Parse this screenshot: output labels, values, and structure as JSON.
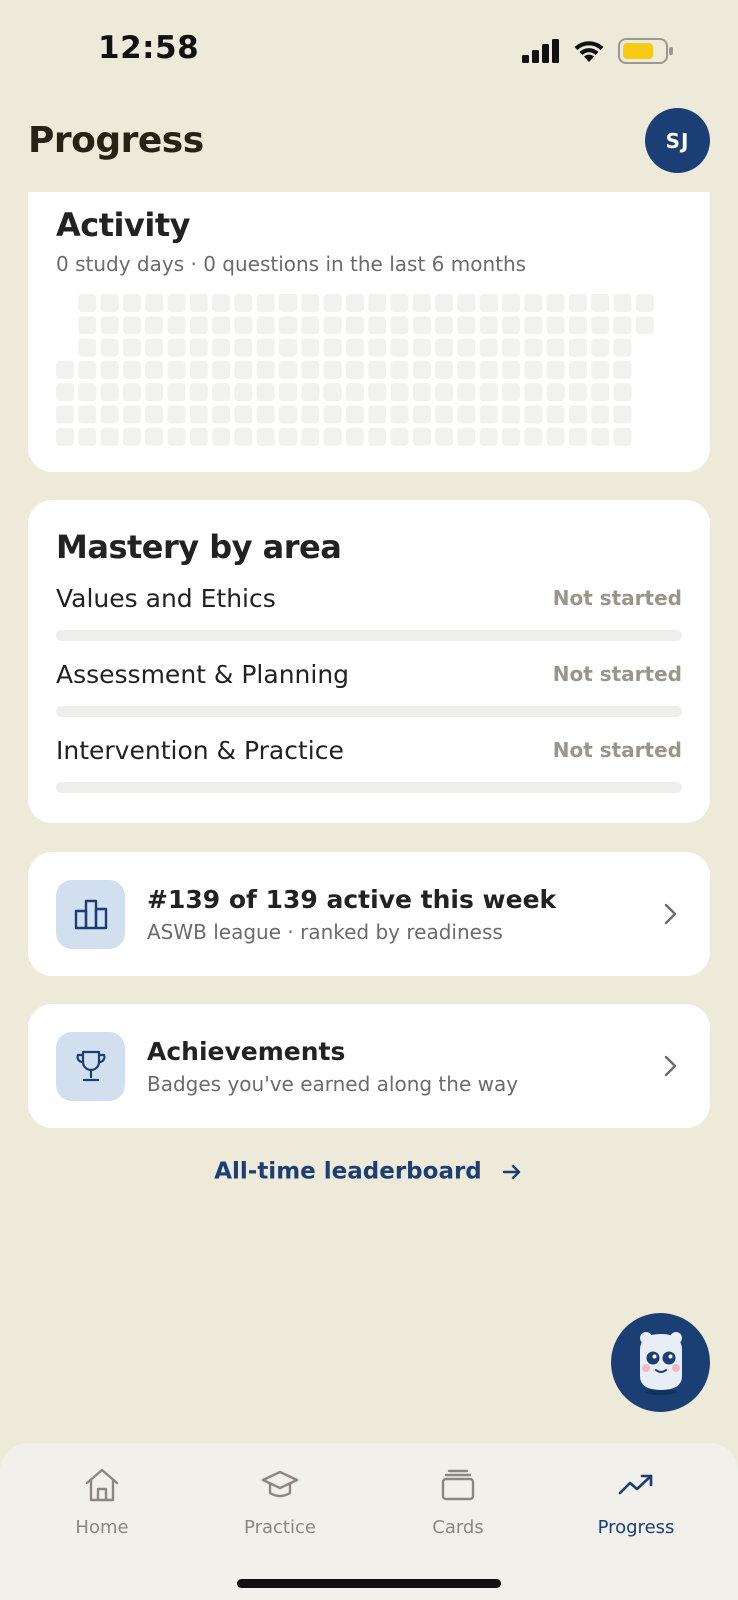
{
  "status_bar": {
    "time": "12:58"
  },
  "header": {
    "title": "Progress",
    "avatar_initials": "SJ"
  },
  "activity": {
    "title": "Activity",
    "subtitle": "0 study days · 0 questions in the last 6 months",
    "study_days": 0,
    "questions": 0
  },
  "mastery": {
    "title": "Mastery by area",
    "areas": [
      {
        "name": "Values and Ethics",
        "status": "Not started",
        "progress": 0
      },
      {
        "name": "Assessment & Planning",
        "status": "Not started",
        "progress": 0
      },
      {
        "name": "Intervention & Practice",
        "status": "Not started",
        "progress": 0
      }
    ]
  },
  "league": {
    "title": "#139 of 139 active this week",
    "subtitle": "ASWB league · ranked by readiness"
  },
  "achievements": {
    "title": "Achievements",
    "subtitle": "Badges you've earned along the way"
  },
  "all_time_link": "All-time leaderboard",
  "tabs": [
    {
      "label": "Home",
      "icon": "home-icon",
      "active": false
    },
    {
      "label": "Practice",
      "icon": "graduation-cap-icon",
      "active": false
    },
    {
      "label": "Cards",
      "icon": "cards-icon",
      "active": false
    },
    {
      "label": "Progress",
      "icon": "trending-up-icon",
      "active": true
    }
  ],
  "colors": {
    "accent": "#1B3F74",
    "background": "#EEEADA",
    "icon_tile": "#D2DFEE",
    "heatmap_empty": "#F1F1EF"
  }
}
